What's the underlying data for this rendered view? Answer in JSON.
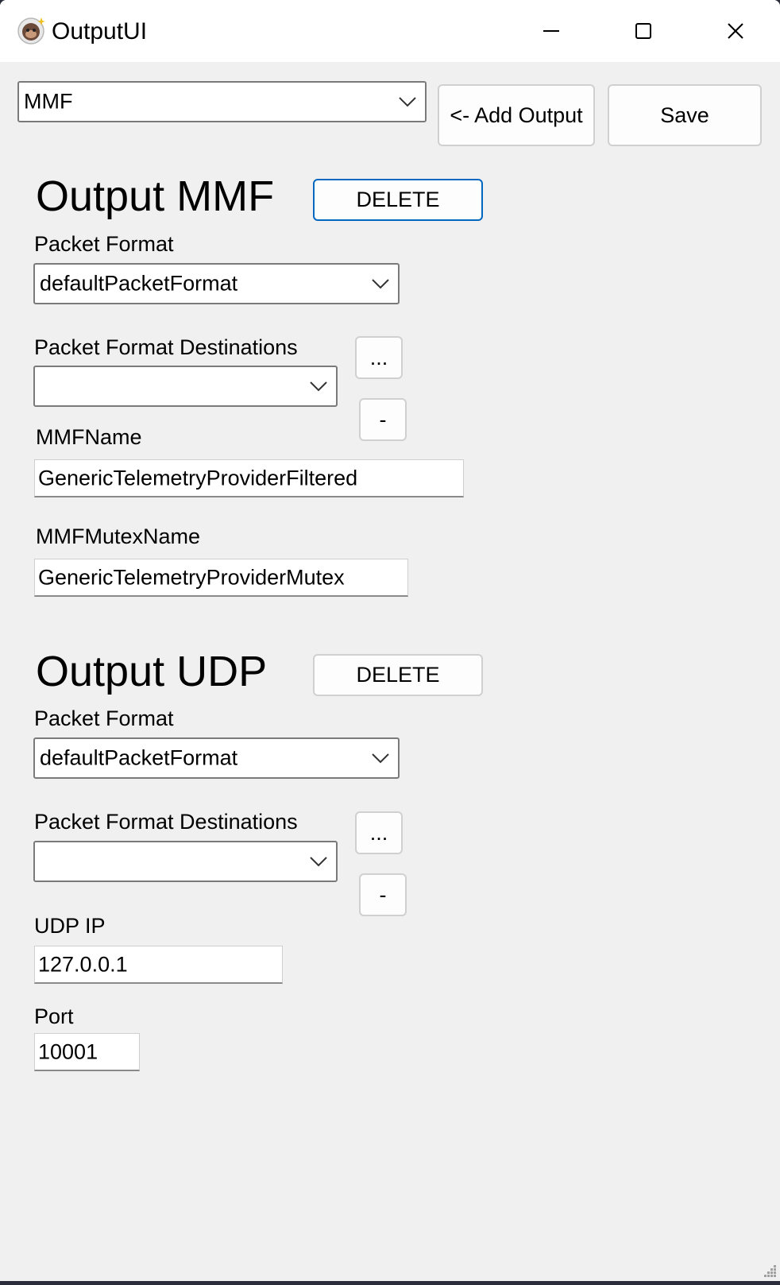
{
  "window": {
    "title": "OutputUI",
    "icon": "astronaut-monkey-icon",
    "controls": [
      "minimize-icon",
      "maximize-icon",
      "close-icon"
    ]
  },
  "toolbar": {
    "output_type_selected": "MMF",
    "add_output_label": "<- Add Output",
    "save_label": "Save"
  },
  "outputs": [
    {
      "title": "Output MMF",
      "delete_label": "DELETE",
      "packet_format_label": "Packet Format",
      "packet_format_value": "defaultPacketFormat",
      "destinations_label": "Packet Format Destinations",
      "destinations_value": "",
      "browse_label": "...",
      "remove_label": "-",
      "fields": [
        {
          "label": "MMFName",
          "value": "GenericTelemetryProviderFiltered"
        },
        {
          "label": "MMFMutexName",
          "value": "GenericTelemetryProviderMutex"
        }
      ]
    },
    {
      "title": "Output UDP",
      "delete_label": "DELETE",
      "packet_format_label": "Packet Format",
      "packet_format_value": "defaultPacketFormat",
      "destinations_label": "Packet Format Destinations",
      "destinations_value": "",
      "browse_label": "...",
      "remove_label": "-",
      "fields": [
        {
          "label": "UDP IP",
          "value": "127.0.0.1"
        },
        {
          "label": "Port",
          "value": "10001"
        }
      ]
    }
  ]
}
